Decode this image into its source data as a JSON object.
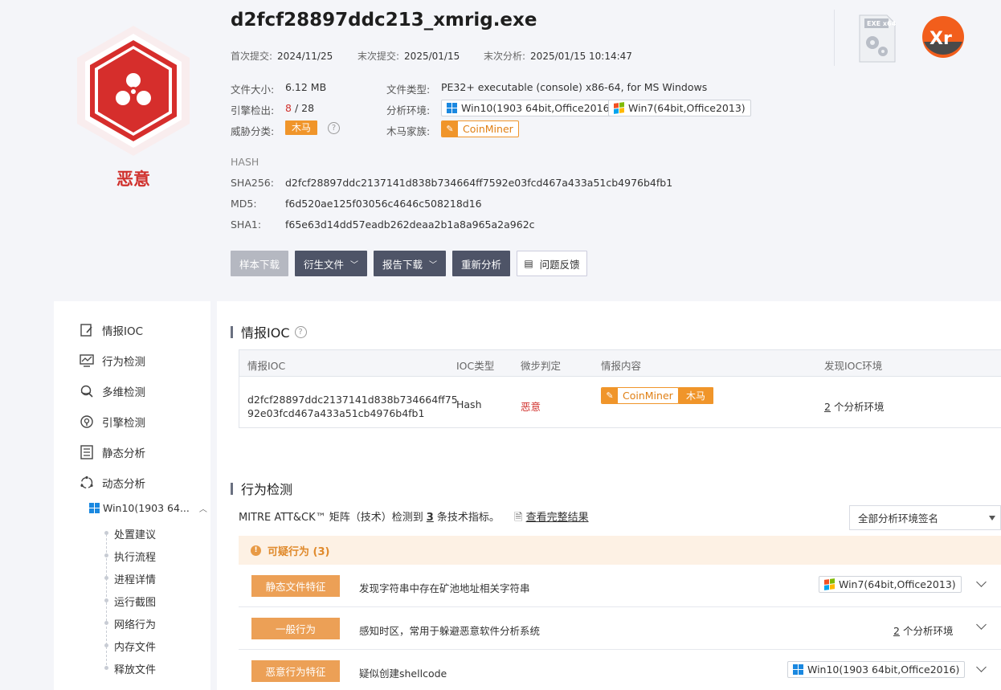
{
  "header": {
    "filename": "d2fcf28897ddc213_xmrig.exe",
    "verdict": "恶意",
    "first_submit_label": "首次提交:",
    "first_submit": "2024/11/25",
    "last_submit_label": "末次提交:",
    "last_submit": "2025/01/15",
    "last_analysis_label": "末次分析:",
    "last_analysis": "2025/01/15 10:14:47",
    "file_size_label": "文件大小:",
    "file_size": "6.12 MB",
    "file_type_label": "文件类型:",
    "file_type": "PE32+ executable (console) x86-64, for MS Windows",
    "engine_label": "引擎检出:",
    "engine_detected": "8",
    "engine_total": "/ 28",
    "env_label": "分析环境:",
    "env1": "Win10(1903 64bit,Office2016)",
    "env2": "Win7(64bit,Office2013)",
    "threat_label": "威胁分类:",
    "threat_tag": "木马",
    "family_label": "木马家族:",
    "family": "CoinMiner",
    "hash_title": "HASH",
    "sha256_label": "SHA256:",
    "sha256": "d2fcf28897ddc2137141d838b734664ff7592e03fcd467a433a51cb4976b4fb1",
    "md5_label": "MD5:",
    "md5": "f6d520ae125f03056c4646c508218d16",
    "sha1_label": "SHA1:",
    "sha1": "f65e63d14dd57eadb262deaa2b1a8a965a2a962c",
    "exe_icon_text": "EXE x64",
    "app_logo_text": "Xr"
  },
  "actions": {
    "download_sample": "样本下载",
    "derived_files": "衍生文件",
    "report_download": "报告下载",
    "reanalyze": "重新分析",
    "feedback": "问题反馈"
  },
  "sidebar": {
    "items": [
      {
        "label": "情报IOC",
        "icon": "document-edit-icon"
      },
      {
        "label": "行为检测",
        "icon": "chart-monitor-icon"
      },
      {
        "label": "多维检测",
        "icon": "multi-scan-icon"
      },
      {
        "label": "引擎检测",
        "icon": "engine-icon"
      },
      {
        "label": "静态分析",
        "icon": "list-doc-icon"
      },
      {
        "label": "动态分析",
        "icon": "cycle-icon"
      }
    ],
    "env_item": "Win10(1903 64...",
    "sub_items": [
      "处置建议",
      "执行流程",
      "进程详情",
      "运行截图",
      "网络行为",
      "内存文件",
      "释放文件"
    ]
  },
  "ioc": {
    "title": "情报IOC",
    "columns": [
      "情报IOC",
      "IOC类型",
      "微步判定",
      "情报内容",
      "发现IOC环境"
    ],
    "row": {
      "ioc_line1": "d2fcf28897ddc2137141d838b734664ff75",
      "ioc_line2": "92e03fcd467a433a51cb4976b4fb1",
      "type": "Hash",
      "verdict": "恶意",
      "family": "CoinMiner",
      "tag": "木马",
      "env_count": "2",
      "env_suffix": "个分析环境"
    }
  },
  "behavior": {
    "title": "行为检测",
    "mitre_prefix": "MITRE ATT&CK™ 矩阵（技术）检测到",
    "mitre_count": "3",
    "mitre_suffix": "条技术指标。",
    "full_results": "查看完整结果",
    "filter": "全部分析环境签名",
    "suspicious_header": "可疑行为 (3)",
    "rows": [
      {
        "tag": "静态文件特征",
        "desc": "发现字符串中存在矿池地址相关字符串",
        "env": "Win7(64bit,Office2013)"
      },
      {
        "tag": "一般行为",
        "desc": "感知时区，常用于躲避恶意软件分析系统",
        "env_count": "2",
        "env_suffix": "个分析环境"
      },
      {
        "tag": "恶意行为特征",
        "desc": "疑似创建shellcode",
        "env": "Win10(1903 64bit,Office2016)"
      }
    ]
  }
}
